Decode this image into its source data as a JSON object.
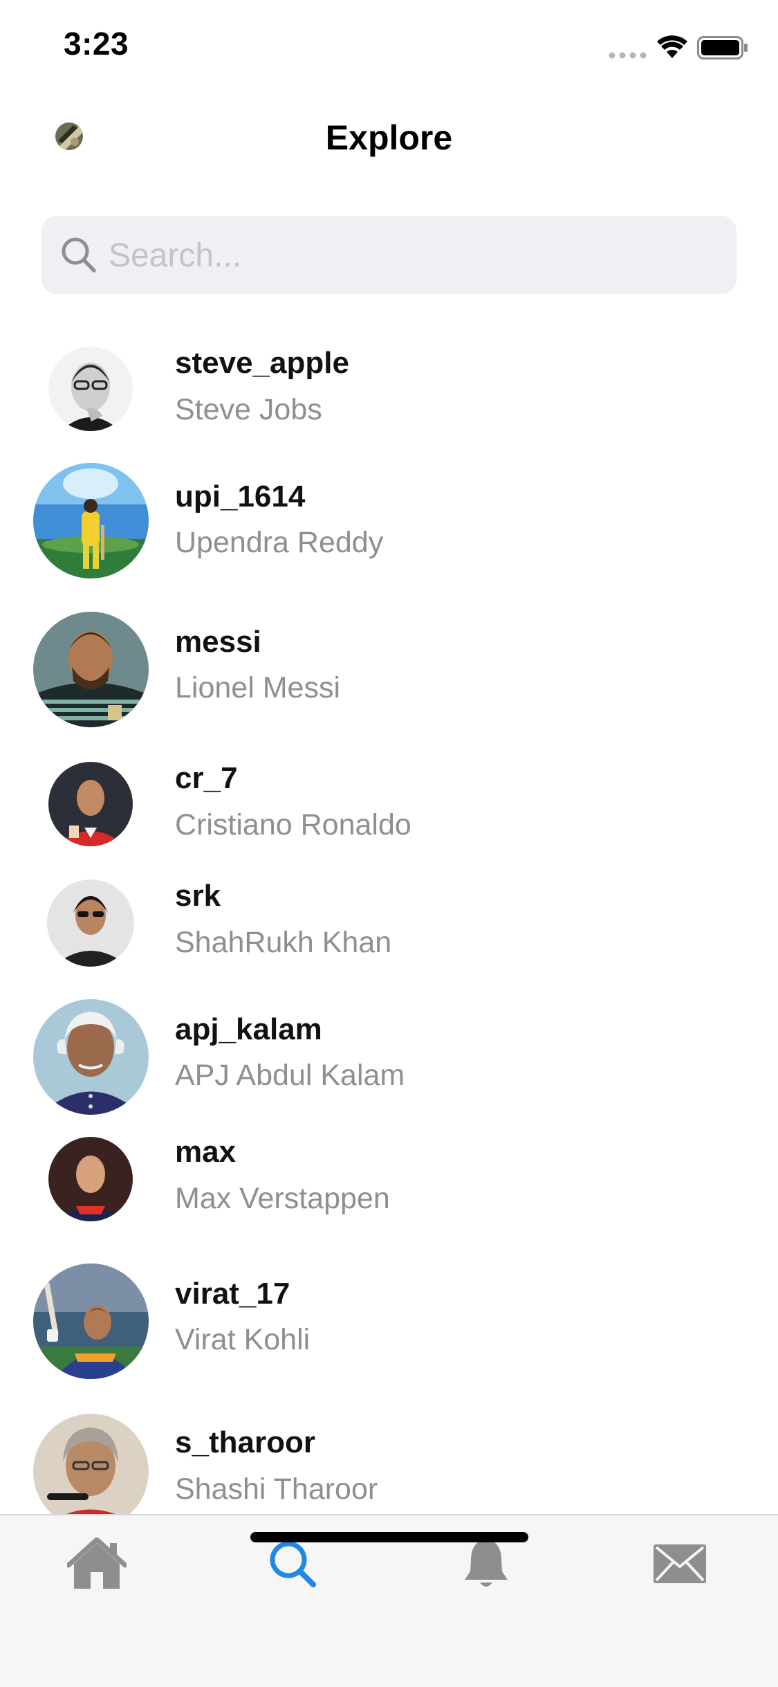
{
  "status_bar": {
    "time": "3:23"
  },
  "header": {
    "title": "Explore"
  },
  "search": {
    "placeholder": "Search..."
  },
  "users": [
    {
      "username": "steve_apple",
      "name": "Steve Jobs"
    },
    {
      "username": "upi_1614",
      "name": "Upendra Reddy"
    },
    {
      "username": "messi",
      "name": "Lionel Messi"
    },
    {
      "username": "cr_7",
      "name": "Cristiano Ronaldo"
    },
    {
      "username": "srk",
      "name": "ShahRukh Khan"
    },
    {
      "username": "apj_kalam",
      "name": "APJ Abdul Kalam"
    },
    {
      "username": "max",
      "name": "Max Verstappen"
    },
    {
      "username": "virat_17",
      "name": "Virat Kohli"
    },
    {
      "username": "s_tharoor",
      "name": "Shashi Tharoor"
    }
  ],
  "tab_bar": {
    "tabs": [
      {
        "icon": "home-icon",
        "active": false
      },
      {
        "icon": "search-icon",
        "active": true
      },
      {
        "icon": "bell-icon",
        "active": false
      },
      {
        "icon": "envelope-icon",
        "active": false
      }
    ]
  },
  "colors": {
    "accent": "#1e88e5",
    "secondary_text": "#8e8e93",
    "tab_inactive": "#8e8e8e"
  }
}
